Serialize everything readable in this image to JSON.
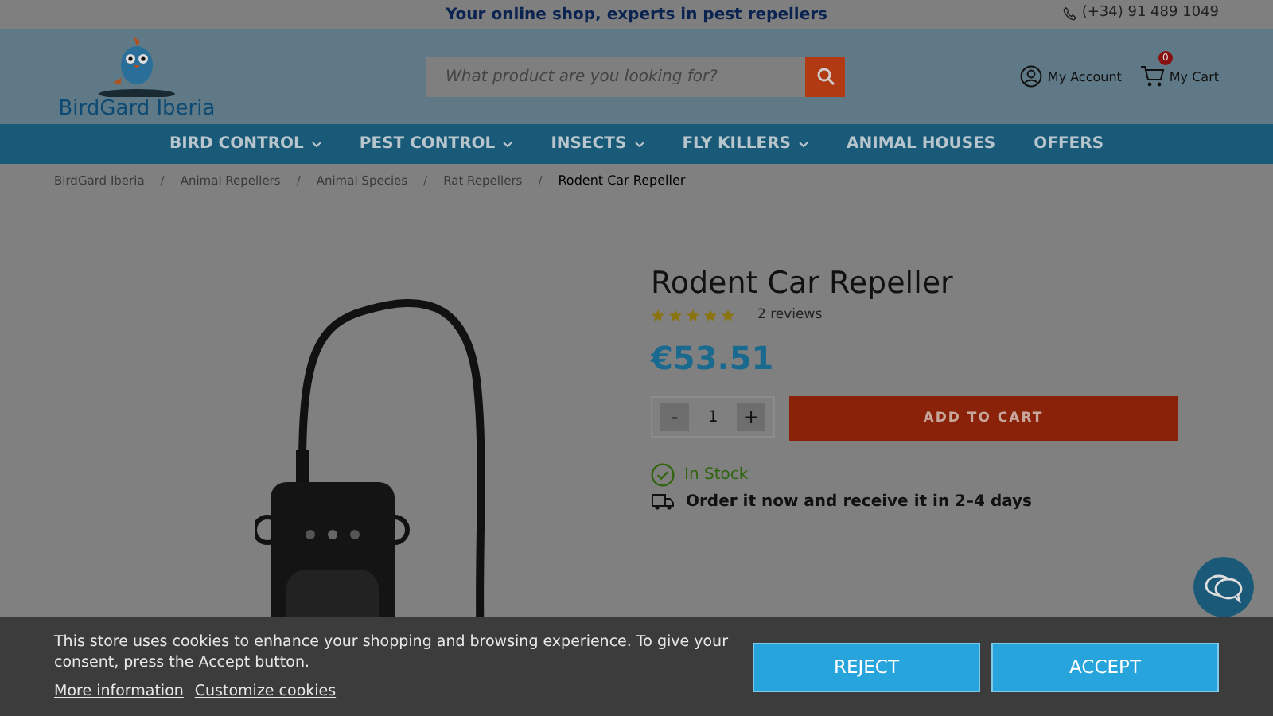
{
  "top_bar": {
    "tagline": "Your online shop, experts in pest repellers",
    "phone": "(+34) 91 489 1049"
  },
  "header": {
    "logo_text": "BirdGard Iberia",
    "search": {
      "placeholder": "What product are you looking for?"
    },
    "account": "My Account",
    "cart": {
      "label": "My Cart",
      "count": "0"
    }
  },
  "nav": [
    {
      "label": "BIRD CONTROL",
      "dropdown": true
    },
    {
      "label": "PEST CONTROL",
      "dropdown": true
    },
    {
      "label": "INSECTS",
      "dropdown": true
    },
    {
      "label": "FLY KILLERS",
      "dropdown": true
    },
    {
      "label": "ANIMAL HOUSES",
      "dropdown": false
    },
    {
      "label": "OFFERS",
      "dropdown": false
    }
  ],
  "breadcrumb": [
    {
      "label": "BirdGard Iberia",
      "selected": false
    },
    {
      "separator": "/",
      "label": "Animal Repellers",
      "selected": false
    },
    {
      "separator": "/",
      "label": "Animal Species",
      "selected": false
    },
    {
      "separator": "/",
      "label": "Rat Repellers",
      "selected": false
    },
    {
      "separator": "/",
      "label": "Rodent Car Repeller",
      "selected": true
    }
  ],
  "product": {
    "title": "Rodent Car Repeller",
    "stars": 5,
    "reviews": "2 reviews",
    "price": "€53.51",
    "quantity": {
      "minus": "-",
      "value": "1",
      "plus": "+"
    },
    "add_to_cart": "ADD TO CART",
    "stock": "In Stock",
    "delivery": "Order it now and receive it in 2–4 days"
  },
  "cookie_banner": {
    "message": "This store uses cookies to enhance your shopping and browsing experience. To give your consent, press the Accept button.",
    "links": [
      "More information",
      "Customize cookies"
    ],
    "buttons": [
      "REJECT",
      "ACCEPT"
    ]
  }
}
